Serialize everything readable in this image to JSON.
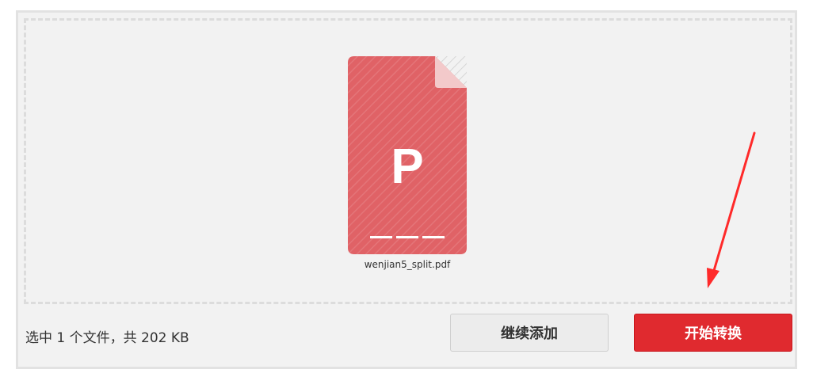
{
  "file": {
    "name": "wenjian5_split.pdf",
    "icon_letter": "P",
    "icon_color": "#e06266"
  },
  "summary_text": "选中 1 个文件，共 202 KB",
  "buttons": {
    "add_more": "继续添加",
    "start_convert": "开始转换"
  },
  "colors": {
    "accent": "#e02a2f",
    "annotation_arrow": "#ff2a2a"
  }
}
